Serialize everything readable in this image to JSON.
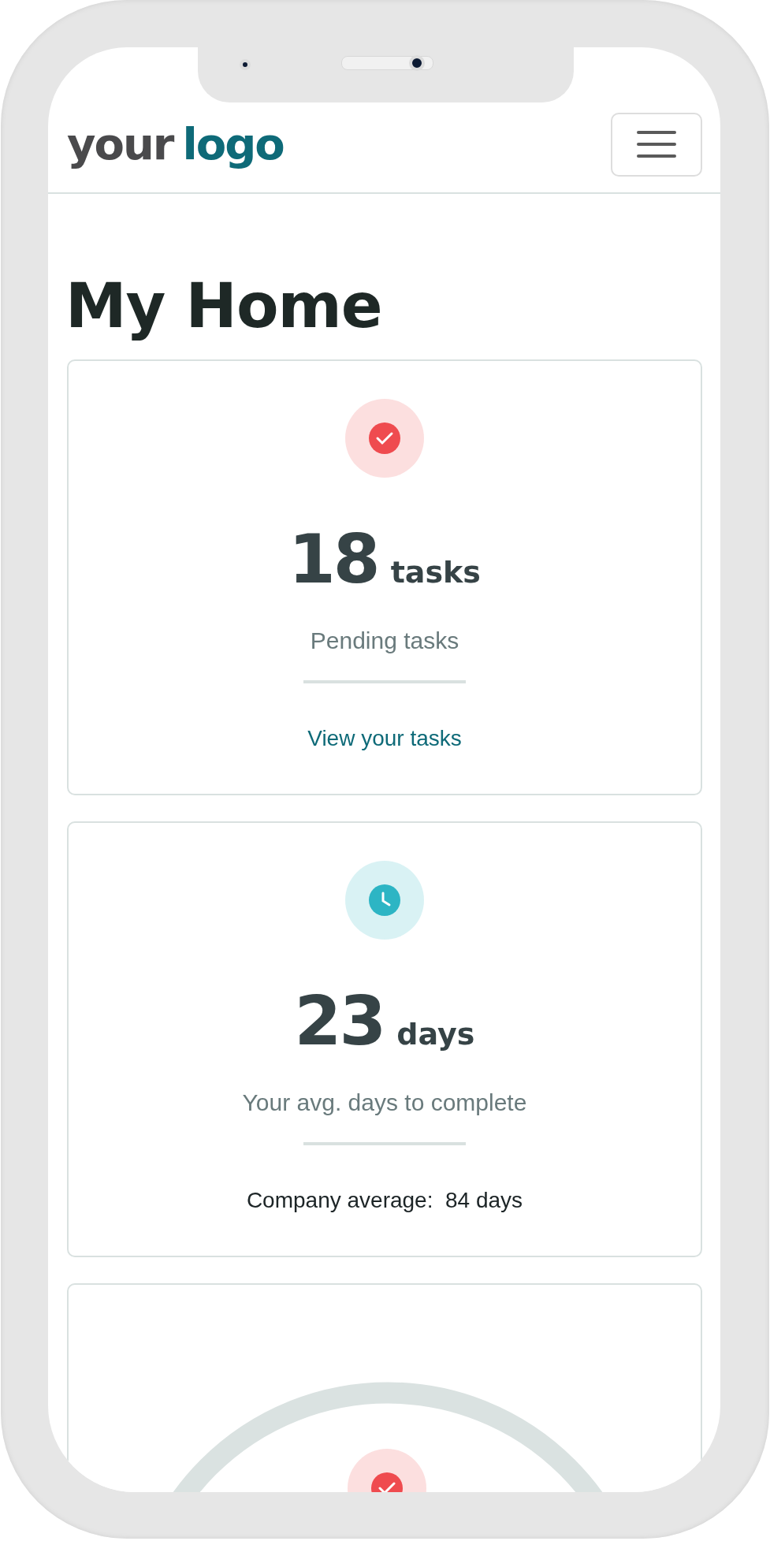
{
  "header": {
    "logo": {
      "dark": "your",
      "accent": "logo"
    }
  },
  "page_title": "My Home",
  "cards": [
    {
      "kind": "tasks",
      "color": "#ef4b4f",
      "value": "18",
      "unit": "tasks",
      "caption": "Pending tasks",
      "footer": {
        "kind": "link",
        "text": "View your tasks"
      }
    },
    {
      "kind": "duration",
      "color": "#2db5c4",
      "value": "23",
      "unit": "days",
      "caption": "Your avg. days to complete",
      "footer": {
        "kind": "text",
        "text": "Company average:  84 days"
      }
    },
    {
      "kind": "gauge",
      "color": "#ef4b4f"
    }
  ]
}
